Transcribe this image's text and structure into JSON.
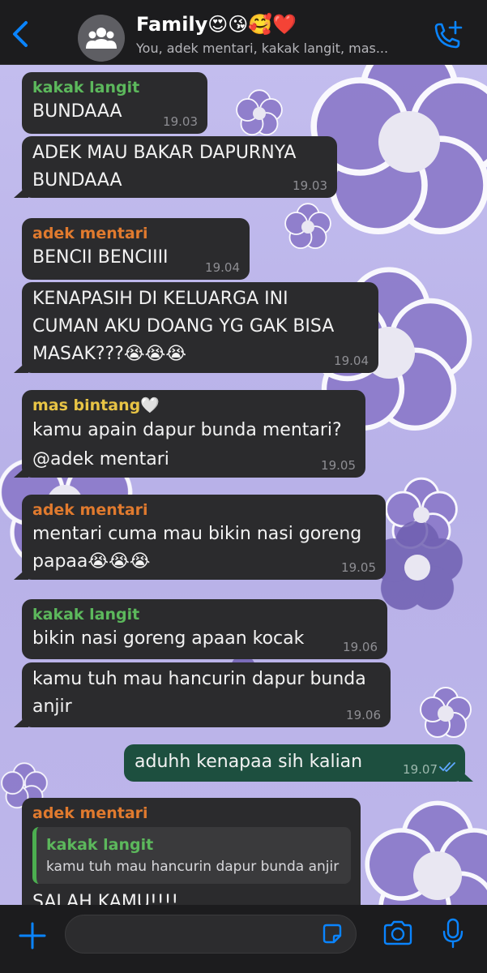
{
  "header": {
    "back_icon": "chevron-left-icon",
    "title": "Family😍😘🥰❤️",
    "subtitle": "You, adek mentari, kakak langit, mas...",
    "call_icon": "add-call-icon",
    "accent": "#0a84ff"
  },
  "messages": [
    {
      "sender": "kakak langit",
      "text": "BUNDAAA",
      "time": "19.03"
    },
    {
      "sender": "",
      "text": "ADEK MAU BAKAR DAPURNYA\nBUNDAAA",
      "time": "19.03"
    },
    {
      "sender": "adek mentari",
      "text": "BENCII BENCIIII",
      "time": "19.04"
    },
    {
      "sender": "",
      "text": "KENAPASIH DI KELUARGA INI\nCUMAN AKU DOANG YG GAK BISA\nMASAK???😭😭😭",
      "time": "19.04"
    },
    {
      "sender": "mas bintang🤍",
      "text": "kamu apain dapur bunda mentari?\n@adek mentari",
      "time": "19.05"
    },
    {
      "sender": "adek mentari",
      "text": "mentari cuma mau bikin nasi goreng\npapaa😭😭😭",
      "time": "19.05"
    },
    {
      "sender": "kakak langit",
      "text": "bikin nasi goreng apaan kocak",
      "time": "19.06"
    },
    {
      "sender": "",
      "text": "kamu tuh mau hancurin dapur bunda\nanjir",
      "time": "19.06"
    },
    {
      "sender": "",
      "text": "aduhh kenapaa sih kalian",
      "time": "19.07"
    },
    {
      "sender": "adek mentari",
      "quote_sender": "kakak langit",
      "quote_text": "kamu tuh mau hancurin dapur bunda anjir",
      "text": "SALAH KAMU!!!!"
    }
  ],
  "input": {
    "plus_icon": "plus-icon",
    "sticker_icon": "sticker-icon",
    "camera_icon": "camera-icon",
    "mic_icon": "microphone-icon"
  }
}
